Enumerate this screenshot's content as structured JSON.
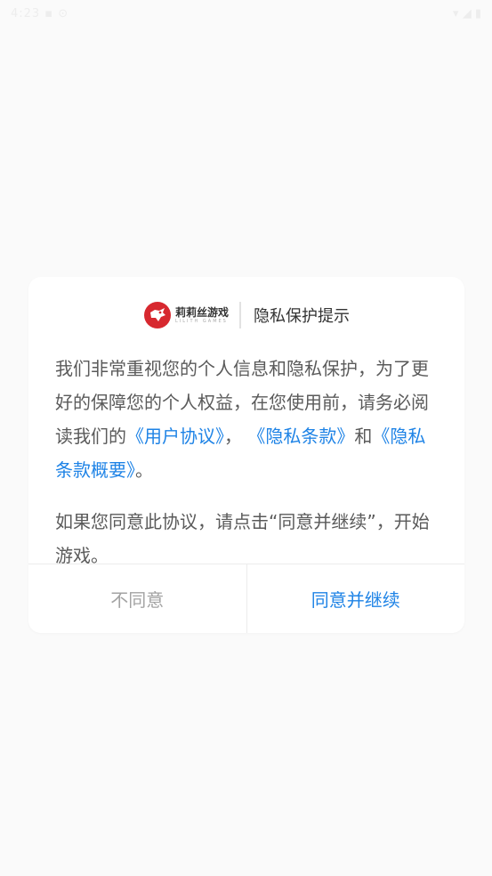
{
  "status_bar": {
    "left_text": "4:23 ▪ ⊙",
    "right_text": "▾ ◢ ▮"
  },
  "dialog": {
    "brand_name": "莉莉丝游戏",
    "brand_sub": "LILITH GAMES",
    "title": "隐私保护提示",
    "content": {
      "p1_part1": "我们非常重视您的个人信息和隐私保护，为了更好的保障您的个人权益，在您使用前，请务必阅读我们的",
      "link_user_agreement": "《用户协议》",
      "p1_sep1": "，",
      "link_privacy_terms": "《隐私条款》",
      "p1_and": "和",
      "link_privacy_summary": "《隐私条款概要》",
      "p1_end": "。",
      "p2": "如果您同意此协议，请点击“同意并继续”，开始游戏。"
    },
    "buttons": {
      "disagree": "不同意",
      "agree": "同意并继续"
    }
  },
  "colors": {
    "accent": "#1e83e6",
    "background": "#fafafa",
    "dialog_bg": "#ffffff",
    "brand_red": "#d7282f"
  }
}
